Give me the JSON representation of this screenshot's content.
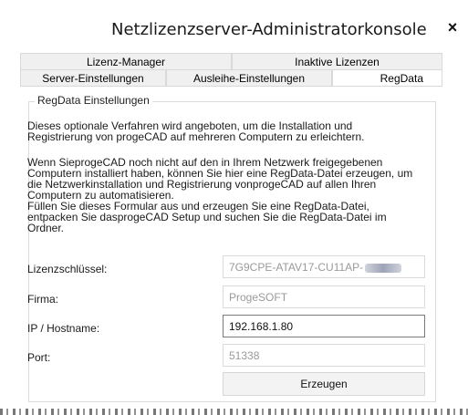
{
  "window": {
    "title": "Netzlizenzserver-Administratorkonsole",
    "close_glyph": "×"
  },
  "tabs": {
    "row1": [
      {
        "label": "Lizenz-Manager"
      },
      {
        "label": "Inaktive Lizenzen"
      }
    ],
    "row2": [
      {
        "label": "Server-Einstellungen"
      },
      {
        "label": "Ausleihe-Einstellungen"
      },
      {
        "label": "RegData",
        "active": true
      }
    ]
  },
  "group": {
    "legend": "RegData Einstellungen",
    "paragraph1_line1": "Dieses optionale Verfahren wird angeboten, um die Installation und",
    "paragraph1_line2": "Registrierung von progeCAD auf mehreren Computern zu erleichtern.",
    "paragraph2_lines": [
      "Wenn SieprogeCAD noch nicht auf den in Ihrem Netzwerk freigegebenen",
      "Computern installiert haben, können Sie hier eine RegData-Datei erzeugen, um",
      "die Netzwerkinstallation und Registrierung vonprogeCAD auf allen Ihren",
      "Computern zu automatisieren.",
      "Füllen Sie dieses Formular aus und erzeugen Sie eine RegData-Datei,",
      "entpacken Sie dasprogeCAD Setup und suchen Sie die RegData-Datei im",
      "Ordner."
    ]
  },
  "form": {
    "license_key_label": "Lizenzschlüssel:",
    "license_key_value": "7G9CPE-ATAV17-CU11AP-",
    "company_label": "Firma:",
    "company_value": "ProgeSOFT",
    "host_label": "IP / Hostname:",
    "host_value": "192.168.1.80",
    "port_label": "Port:",
    "port_value": "51338",
    "generate_button": "Erzeugen"
  }
}
